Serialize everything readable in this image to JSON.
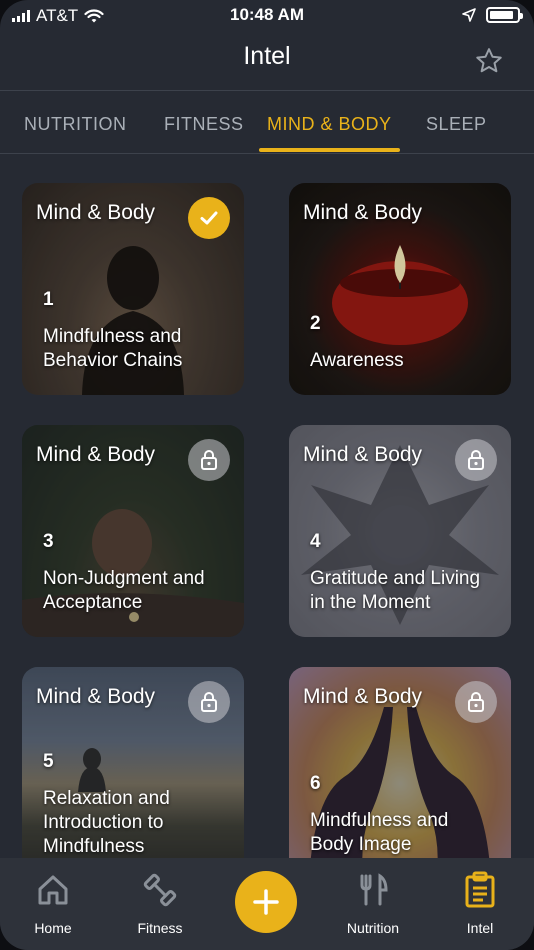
{
  "status": {
    "carrier": "AT&T",
    "time": "10:48 AM",
    "battery_level": 0.9
  },
  "header": {
    "title": "Intel"
  },
  "tabs": [
    {
      "label": "NUTRITION",
      "active": false
    },
    {
      "label": "FITNESS",
      "active": false
    },
    {
      "label": "MIND & BODY",
      "active": true
    },
    {
      "label": "SLEEP",
      "active": false
    }
  ],
  "cards": [
    {
      "category": "Mind & Body",
      "number": "1",
      "title_line1": "Mindfulness and",
      "title_line2": "Behavior Chains",
      "title_line3": "",
      "state": "completed"
    },
    {
      "category": "Mind & Body",
      "number": "2",
      "title_line1": "Awareness",
      "title_line2": "",
      "title_line3": "",
      "state": "open"
    },
    {
      "category": "Mind & Body",
      "number": "3",
      "title_line1": "Non-Judgment and",
      "title_line2": "Acceptance",
      "title_line3": "",
      "state": "locked"
    },
    {
      "category": "Mind & Body",
      "number": "4",
      "title_line1": "Gratitude and Living",
      "title_line2": "in the Moment",
      "title_line3": "",
      "state": "locked"
    },
    {
      "category": "Mind & Body",
      "number": "5",
      "title_line1": "Relaxation and",
      "title_line2": "Introduction to",
      "title_line3": "Mindfulness",
      "state": "locked"
    },
    {
      "category": "Mind & Body",
      "number": "6",
      "title_line1": "Mindfulness and",
      "title_line2": "Body Image",
      "title_line3": "",
      "state": "locked"
    }
  ],
  "nav": {
    "items": [
      {
        "label": "Home",
        "icon": "home-icon",
        "active": false
      },
      {
        "label": "Fitness",
        "icon": "dumbbell-icon",
        "active": false
      },
      {
        "label": "Nutrition",
        "icon": "fork-knife-icon",
        "active": false
      },
      {
        "label": "Intel",
        "icon": "clipboard-icon",
        "active": true
      }
    ],
    "add_icon": "plus-icon"
  },
  "colors": {
    "accent": "#e9b21a",
    "background": "#262a33",
    "tab_inactive": "#aab0b8"
  }
}
